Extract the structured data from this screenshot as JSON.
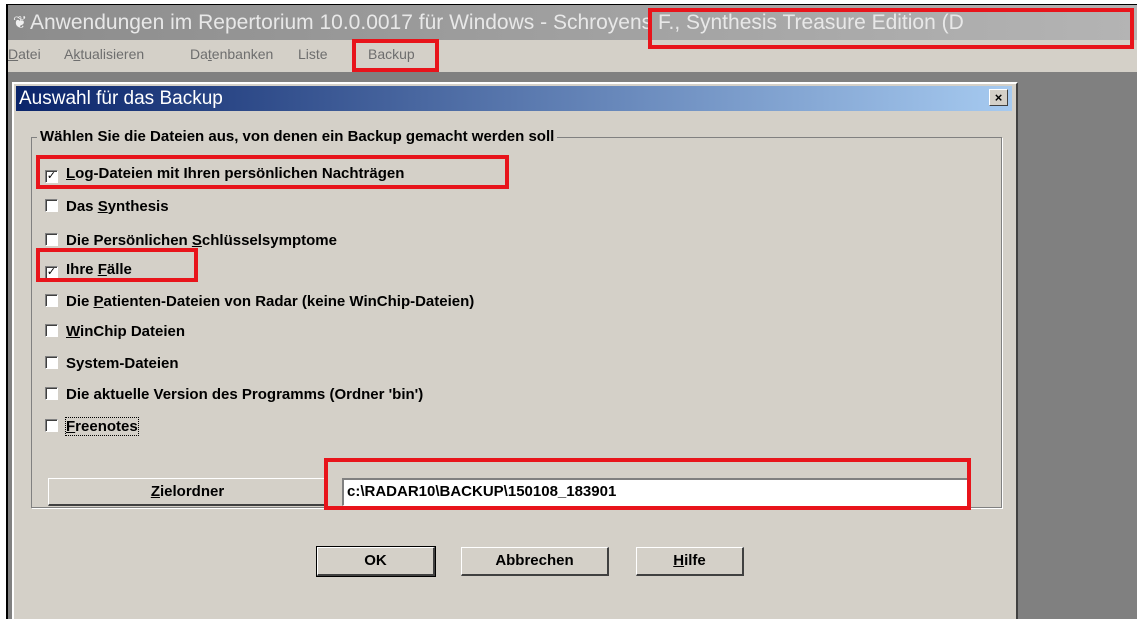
{
  "window": {
    "title": "Anwendungen im Repertorium 10.0.0017 für Windows - Schroyens F., Synthesis Treasure Edition (D",
    "icon": "radar-app-icon"
  },
  "menu": {
    "items": [
      "Datei",
      "Aktualisieren",
      "Datenbanken",
      "Liste",
      "Backup"
    ]
  },
  "dialog": {
    "title": "Auswahl für das Backup",
    "close_label": "×",
    "group_label": "Wählen Sie die Dateien aus, von denen ein Backup gemacht werden soll",
    "checkboxes": [
      {
        "label": "Log-Dateien mit Ihren persönlichen Nachträgen",
        "checked": true
      },
      {
        "label": "Das Synthesis",
        "checked": false
      },
      {
        "label": "Die Persönlichen Schlüsselsymptome",
        "checked": false
      },
      {
        "label": "Ihre Fälle",
        "checked": true
      },
      {
        "label": "Die  Patienten-Dateien von Radar (keine WinChip-Dateien)",
        "checked": false
      },
      {
        "label": "WinChip Dateien",
        "checked": false
      },
      {
        "label": "System-Dateien",
        "checked": false
      },
      {
        "label": "Die aktuelle Version des Programms (Ordner 'bin')",
        "checked": false
      },
      {
        "label": "Freenotes",
        "checked": false
      }
    ],
    "target_button": "Zielordner",
    "target_path": "c:\\RADAR10\\BACKUP\\150108_183901",
    "buttons": {
      "ok": "OK",
      "cancel": "Abbrechen",
      "help": "Hilfe"
    }
  },
  "colors": {
    "highlight": "#e8141b",
    "dialog_title_start": "#0a246a",
    "dialog_title_end": "#a6caf0",
    "face": "#d4d0c8"
  }
}
